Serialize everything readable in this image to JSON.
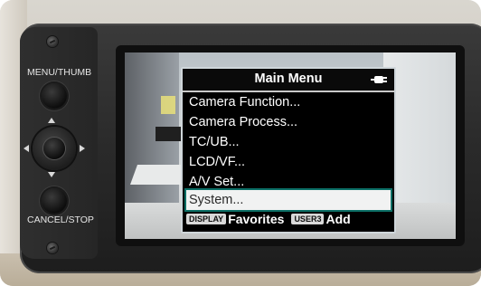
{
  "camera": {
    "menu_thumb_label": "MENU/THUMB",
    "cancel_stop_label": "CANCEL/STOP"
  },
  "menu": {
    "title": "Main Menu",
    "power_icon": "ac-power-plug-icon",
    "items": [
      {
        "label": "Camera Function..."
      },
      {
        "label": "Camera Process..."
      },
      {
        "label": "TC/UB..."
      },
      {
        "label": "LCD/VF..."
      },
      {
        "label": "A/V Set..."
      },
      {
        "label": "System..."
      }
    ],
    "selected_index": 5,
    "footer": {
      "display_tag": "DISPLAY",
      "favorites_label": "Favorites",
      "user3_tag": "USER3",
      "add_label": "Add"
    }
  },
  "colors": {
    "selection_outline": "#0c6f66",
    "menu_background": "#000000",
    "menu_text": "#ffffff"
  }
}
